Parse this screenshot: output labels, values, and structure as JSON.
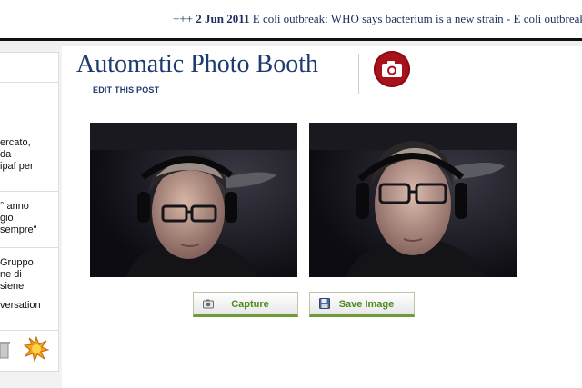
{
  "ticker": {
    "prefix": "+++",
    "date": "2 Jun 2011",
    "headline": "E coli outbreak: WHO says bacterium is a new strain - E coli outbreak: WHO says"
  },
  "sidebar": {
    "snippets": [
      "ercato,",
      "da",
      "ipaf per",
      "° anno",
      "gio",
      "sempre\"",
      "Gruppo",
      "ne di",
      "siene",
      "versation"
    ]
  },
  "post": {
    "title": "Automatic Photo Booth",
    "edit_link": "EDIT THIS POST",
    "camera_icon": "camera-icon",
    "brand_color": "#a8121a"
  },
  "actions": {
    "capture_label": "Capture",
    "save_label": "Save Image"
  }
}
